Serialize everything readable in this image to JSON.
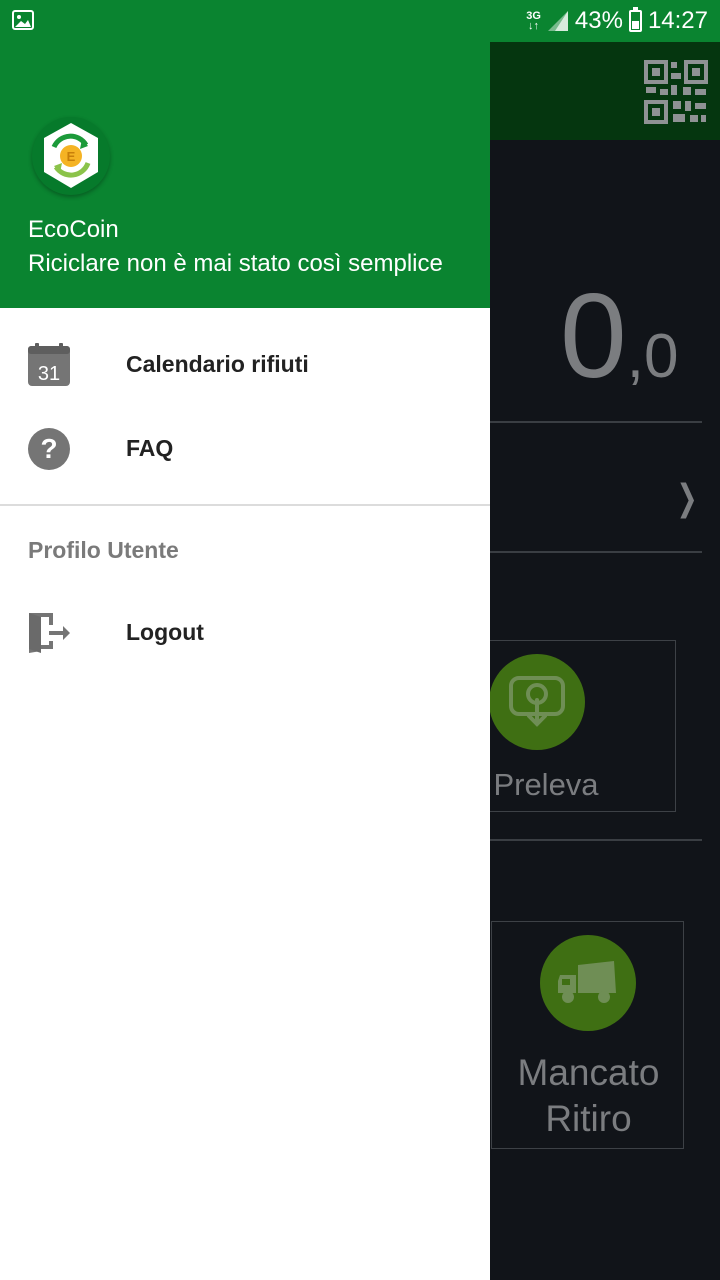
{
  "status_bar": {
    "network": "3G",
    "battery_percent": "43%",
    "battery_level": 0.43,
    "time": "14:27"
  },
  "drawer": {
    "header": {
      "app_name": "EcoCoin",
      "tagline": "Riciclare non è mai stato così semplice"
    },
    "items": [
      {
        "label": "Calendario rifiuti",
        "icon": "calendar-icon",
        "icon_text": "31"
      },
      {
        "label": "FAQ",
        "icon": "help-icon"
      }
    ],
    "section_title": "Profilo Utente",
    "section_items": [
      {
        "label": "Logout",
        "icon": "logout-icon"
      }
    ]
  },
  "background_app": {
    "balance_integer": "0",
    "balance_decimal": ",0",
    "cards": [
      {
        "label": "Preleva",
        "icon": "withdraw-icon"
      },
      {
        "label_line1": "Mancato",
        "label_line2": "Ritiro",
        "icon": "truck-icon"
      }
    ]
  },
  "colors": {
    "primary": "#0a8430",
    "primary_dark": "#05360f",
    "accent_card": "#3f6f13"
  }
}
